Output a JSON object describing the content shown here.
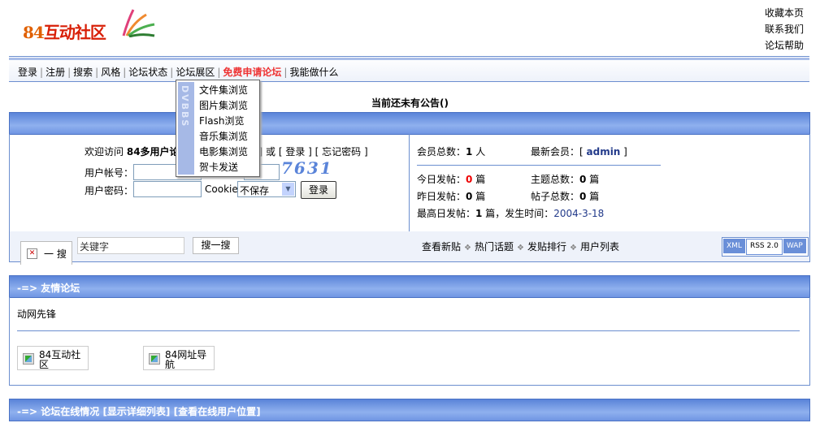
{
  "header": {
    "logo_num": "84",
    "logo_text": "互动社区",
    "top_links": [
      "收藏本页",
      "联系我们",
      "论坛帮助"
    ]
  },
  "menu": {
    "items": [
      "登录",
      "注册",
      "搜索",
      "风格",
      "论坛状态",
      "论坛展区"
    ],
    "highlight": "免费申请论坛",
    "last": "我能做什么"
  },
  "dropdown": {
    "side_text": "DVBBS",
    "items": [
      "文件集浏览",
      "图片集浏览",
      "Flash浏览",
      "音乐集浏览",
      "电影集浏览",
      "贺卡发送"
    ]
  },
  "notice": "当前还未有公告()",
  "login": {
    "welcome_prefix": "欢迎访问",
    "welcome_bold": "84多用户论",
    "welcome_tail": "册] 或 [ 登录 ] [ 忘记密码 ]",
    "user_label": "用户帐号：",
    "pass_label": "用户密码：",
    "captcha": "7631",
    "cookie_label": "Cookie",
    "cookie_value": "不保存",
    "login_button": "登录"
  },
  "stats": {
    "members_label": "会员总数：",
    "members_value": "1",
    "members_unit": " 人",
    "newest_label": "最新会员：[ ",
    "newest_value": "admin",
    "newest_tail": " ]",
    "today_label": "今日发帖：",
    "today_value": "0",
    "today_unit": " 篇",
    "topics_label": "主题总数：",
    "topics_value": "0",
    "topics_unit": " 篇",
    "yesterday_label": "昨日发帖：",
    "yesterday_value": "0",
    "yesterday_unit": " 篇",
    "posts_label": "帖子总数：",
    "posts_value": "0",
    "posts_unit": " 篇",
    "max_label": "最高日发帖：",
    "max_value": "1",
    "max_mid": " 篇，发生时间：",
    "max_date": "2004-3-18"
  },
  "search": {
    "tab_label": "一 搜",
    "keyword_placeholder": "关键字",
    "button": "搜一搜",
    "quick_links": [
      "查看新贴",
      "热门话题",
      "发贴排行",
      "用户列表"
    ],
    "badges": [
      "XML",
      "RSS 2.0",
      "WAP"
    ]
  },
  "friends": {
    "title": "-=> 友情论坛",
    "name": "动网先锋",
    "links": [
      "84互动社区",
      "84网址导航"
    ]
  },
  "online": {
    "title": "-=> 论坛在线情况 [显示详细列表] [查看在线用户位置]"
  },
  "colors": {
    "accent_blue": "#5a84d9",
    "border_blue": "#6b8ecf",
    "highlight_red": "#e33"
  }
}
